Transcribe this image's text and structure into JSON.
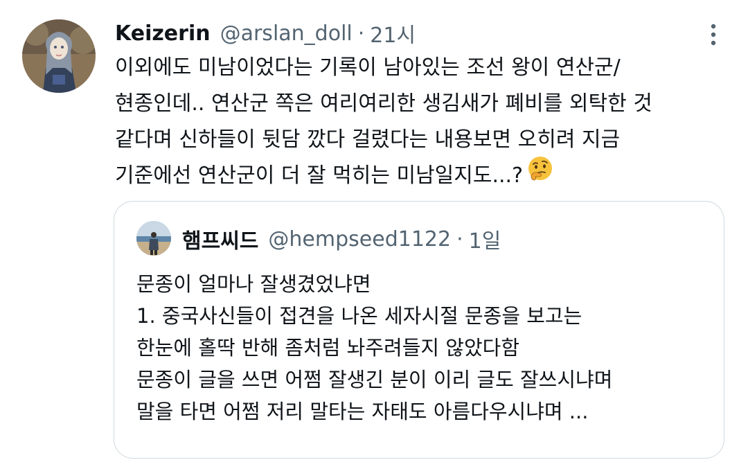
{
  "tweet": {
    "display_name": "Keizerin",
    "handle": "@arslan_doll",
    "separator": "·",
    "time": "21시",
    "text_lines": [
      "이외에도 미남이었다는 기록이 남아있는 조선 왕이 연산군/",
      "현종인데..  연산군 쪽은 여리여리한 생김새가 폐비를 외탁한 것",
      "같다며 신하들이 뒷담 깠다 걸렸다는 내용보면 오히려 지금",
      "기준에선 연산군이 더 잘 먹히는 미남일지도...?"
    ],
    "emoji": "thinking-face-icon",
    "more_icon": "more-vertical-icon"
  },
  "quoted_tweet": {
    "display_name": "햄프씨드",
    "handle": "@hempseed1122",
    "separator": "·",
    "time": "1일",
    "text_lines": [
      "문종이 얼마나 잘생겼었냐면",
      "1. 중국사신들이 접견을 나온 세자시절 문종을 보고는",
      "한눈에 홀딱 반해 좀처럼 놔주려들지 않았다함",
      "문종이 글을 쓰면 어쩜 잘생긴 분이 이리 글도 잘쓰시냐며",
      "말을 타면 어쩜 저리 말타는 자태도 아름다우시냐며 ..."
    ]
  },
  "colors": {
    "text_primary": "#0f1419",
    "text_secondary": "#536471",
    "border": "#cfd9de",
    "emoji_yellow": "#f7c23c"
  }
}
